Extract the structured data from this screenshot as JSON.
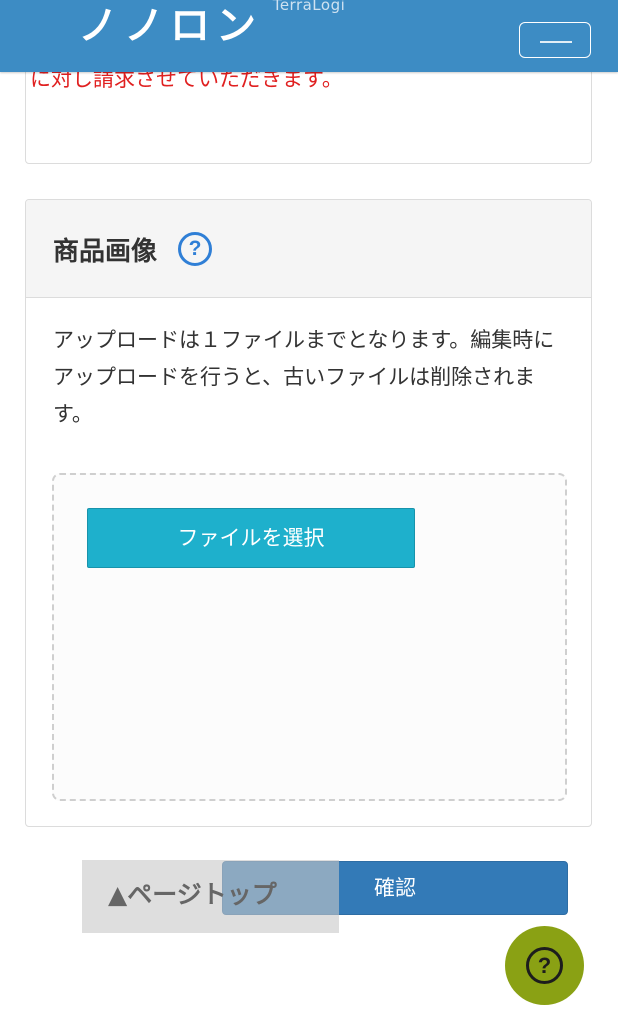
{
  "header": {
    "brand": "TerraLogi",
    "title": "ノノロン",
    "menu_button_icon": "hamburger-icon",
    "background_color": "#3d8cc4"
  },
  "notice_panel": {
    "red_text": "に対し請求させていただきます。"
  },
  "product_image_panel": {
    "title": "商品画像",
    "help_icon": "question-circle-icon",
    "help_glyph": "?",
    "description": "アップロードは１ファイルまでとなります。編集時にアップロードを行うと、古いファイルは削除されます。",
    "file_button_label": "ファイルを選択",
    "file_button_color": "#1eb0cc"
  },
  "actions": {
    "confirm_label": "確認",
    "confirm_color": "#337ab7",
    "page_top_label": "▲ページトップ"
  },
  "floating_help": {
    "icon": "question-circle-icon",
    "glyph": "?",
    "color": "#8aa114"
  }
}
